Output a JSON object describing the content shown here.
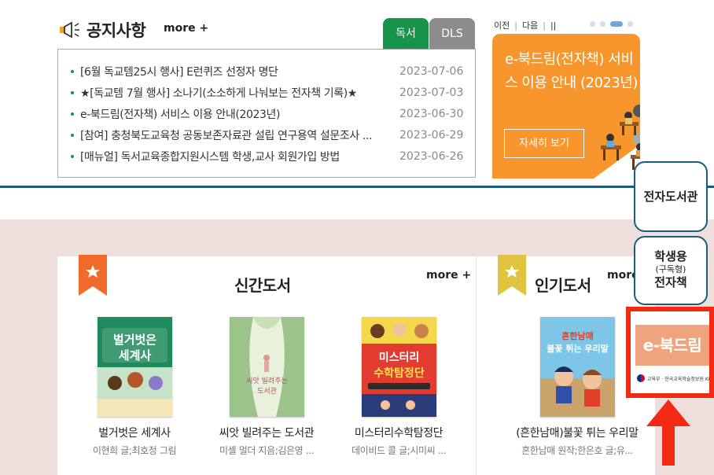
{
  "notice": {
    "title": "공지사항",
    "more": "more +",
    "tabs": [
      "독서",
      "DLS"
    ],
    "items": [
      {
        "text": "[6월 독교템25시 행사] E런퀴즈 선정자 명단",
        "date": "2023-07-06"
      },
      {
        "text": "★[독교템 7월 행사] 소나기(소소하게 나눠보는 전자책 기록)★",
        "date": "2023-07-03"
      },
      {
        "text": "e-북드림(전자책) 서비스 이용 안내(2023년)",
        "date": "2023-06-30"
      },
      {
        "text": "[참여] 충청북도교육청 공동보존자료관 설립 연구용역 설문조사 ...",
        "date": "2023-06-29"
      },
      {
        "text": "[매뉴얼] 독서교육종합지원시스템 학생,교사 회원가입 방법",
        "date": "2023-06-26"
      }
    ]
  },
  "banner": {
    "prev": "이전",
    "next": "다음",
    "pause": "||",
    "title": "e-북드림(전자책) 서비스 이용 안내 (2023년)",
    "button": "자세히 보기"
  },
  "new_books": {
    "title": "신간도서",
    "more": "more +",
    "items": [
      {
        "title": "벌거벗은 세계사",
        "author": "이현희 글;최호정 그림",
        "cover_text": "벌거벗은 세계사",
        "cover_color": "#1f8a5c"
      },
      {
        "title": "씨앗 빌려주는 도서관",
        "author": "미셸 멀더 지음;김은영 ...",
        "cover_text": "씨앗 빌려주는 도서관",
        "cover_color": "#e9f0dc"
      },
      {
        "title": "미스터리수학탐정단",
        "author": "데이비드 콜 글;시미씨 ...",
        "cover_text": "미스터리 수학탐정단",
        "cover_color": "#e23b2f"
      }
    ]
  },
  "popular_books": {
    "title": "인기도서",
    "more": "more +",
    "items": [
      {
        "title": "(흔한남매)불꽃 튀는 우리말",
        "author": "흔한남매 원작;한은호 글;유...",
        "cover_text": "불꽃 튀는 우리말",
        "cover_color": "#7ec6e8"
      }
    ]
  },
  "side": {
    "ebook_library": "전자도서관",
    "student_line1": "학생용",
    "student_line2": "(구독형)",
    "student_line3": "전자책",
    "edream_label": "e-북드림",
    "edream_logo_text": "교육부 · 한국교육학술정보원 KERIS"
  },
  "colors": {
    "green_tab": "#18944a",
    "gray_tab": "#8c8c8c",
    "banner_orange": "#f7962d",
    "navy_rule": "#1a5b7e",
    "highlight_red": "#f22a14",
    "section_bg": "#eedfdc"
  }
}
